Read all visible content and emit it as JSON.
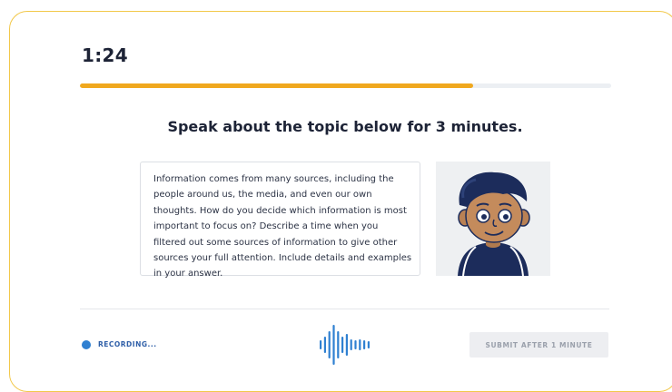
{
  "timer": {
    "value": "1:24"
  },
  "progress": {
    "fraction": 0.74,
    "fill_color": "#f0a81e"
  },
  "prompt": {
    "title": "Speak about the topic below for 3 minutes."
  },
  "topic": {
    "text": "Information comes from many sources, including the people around us, the media, and even our own thoughts. How do you decide which information is most important to focus on? Describe a time when you filtered out some sources of information to give other sources your full attention. Include details and examples in your answer."
  },
  "avatar": {
    "icon": "cartoon-person-avatar"
  },
  "recording": {
    "label": "RECORDING...",
    "dot_color": "#2f80d1"
  },
  "waveform": {
    "icon": "audio-waveform-icon",
    "color": "#2f80d1"
  },
  "submit": {
    "label": "SUBMIT AFTER 1 MINUTE"
  }
}
